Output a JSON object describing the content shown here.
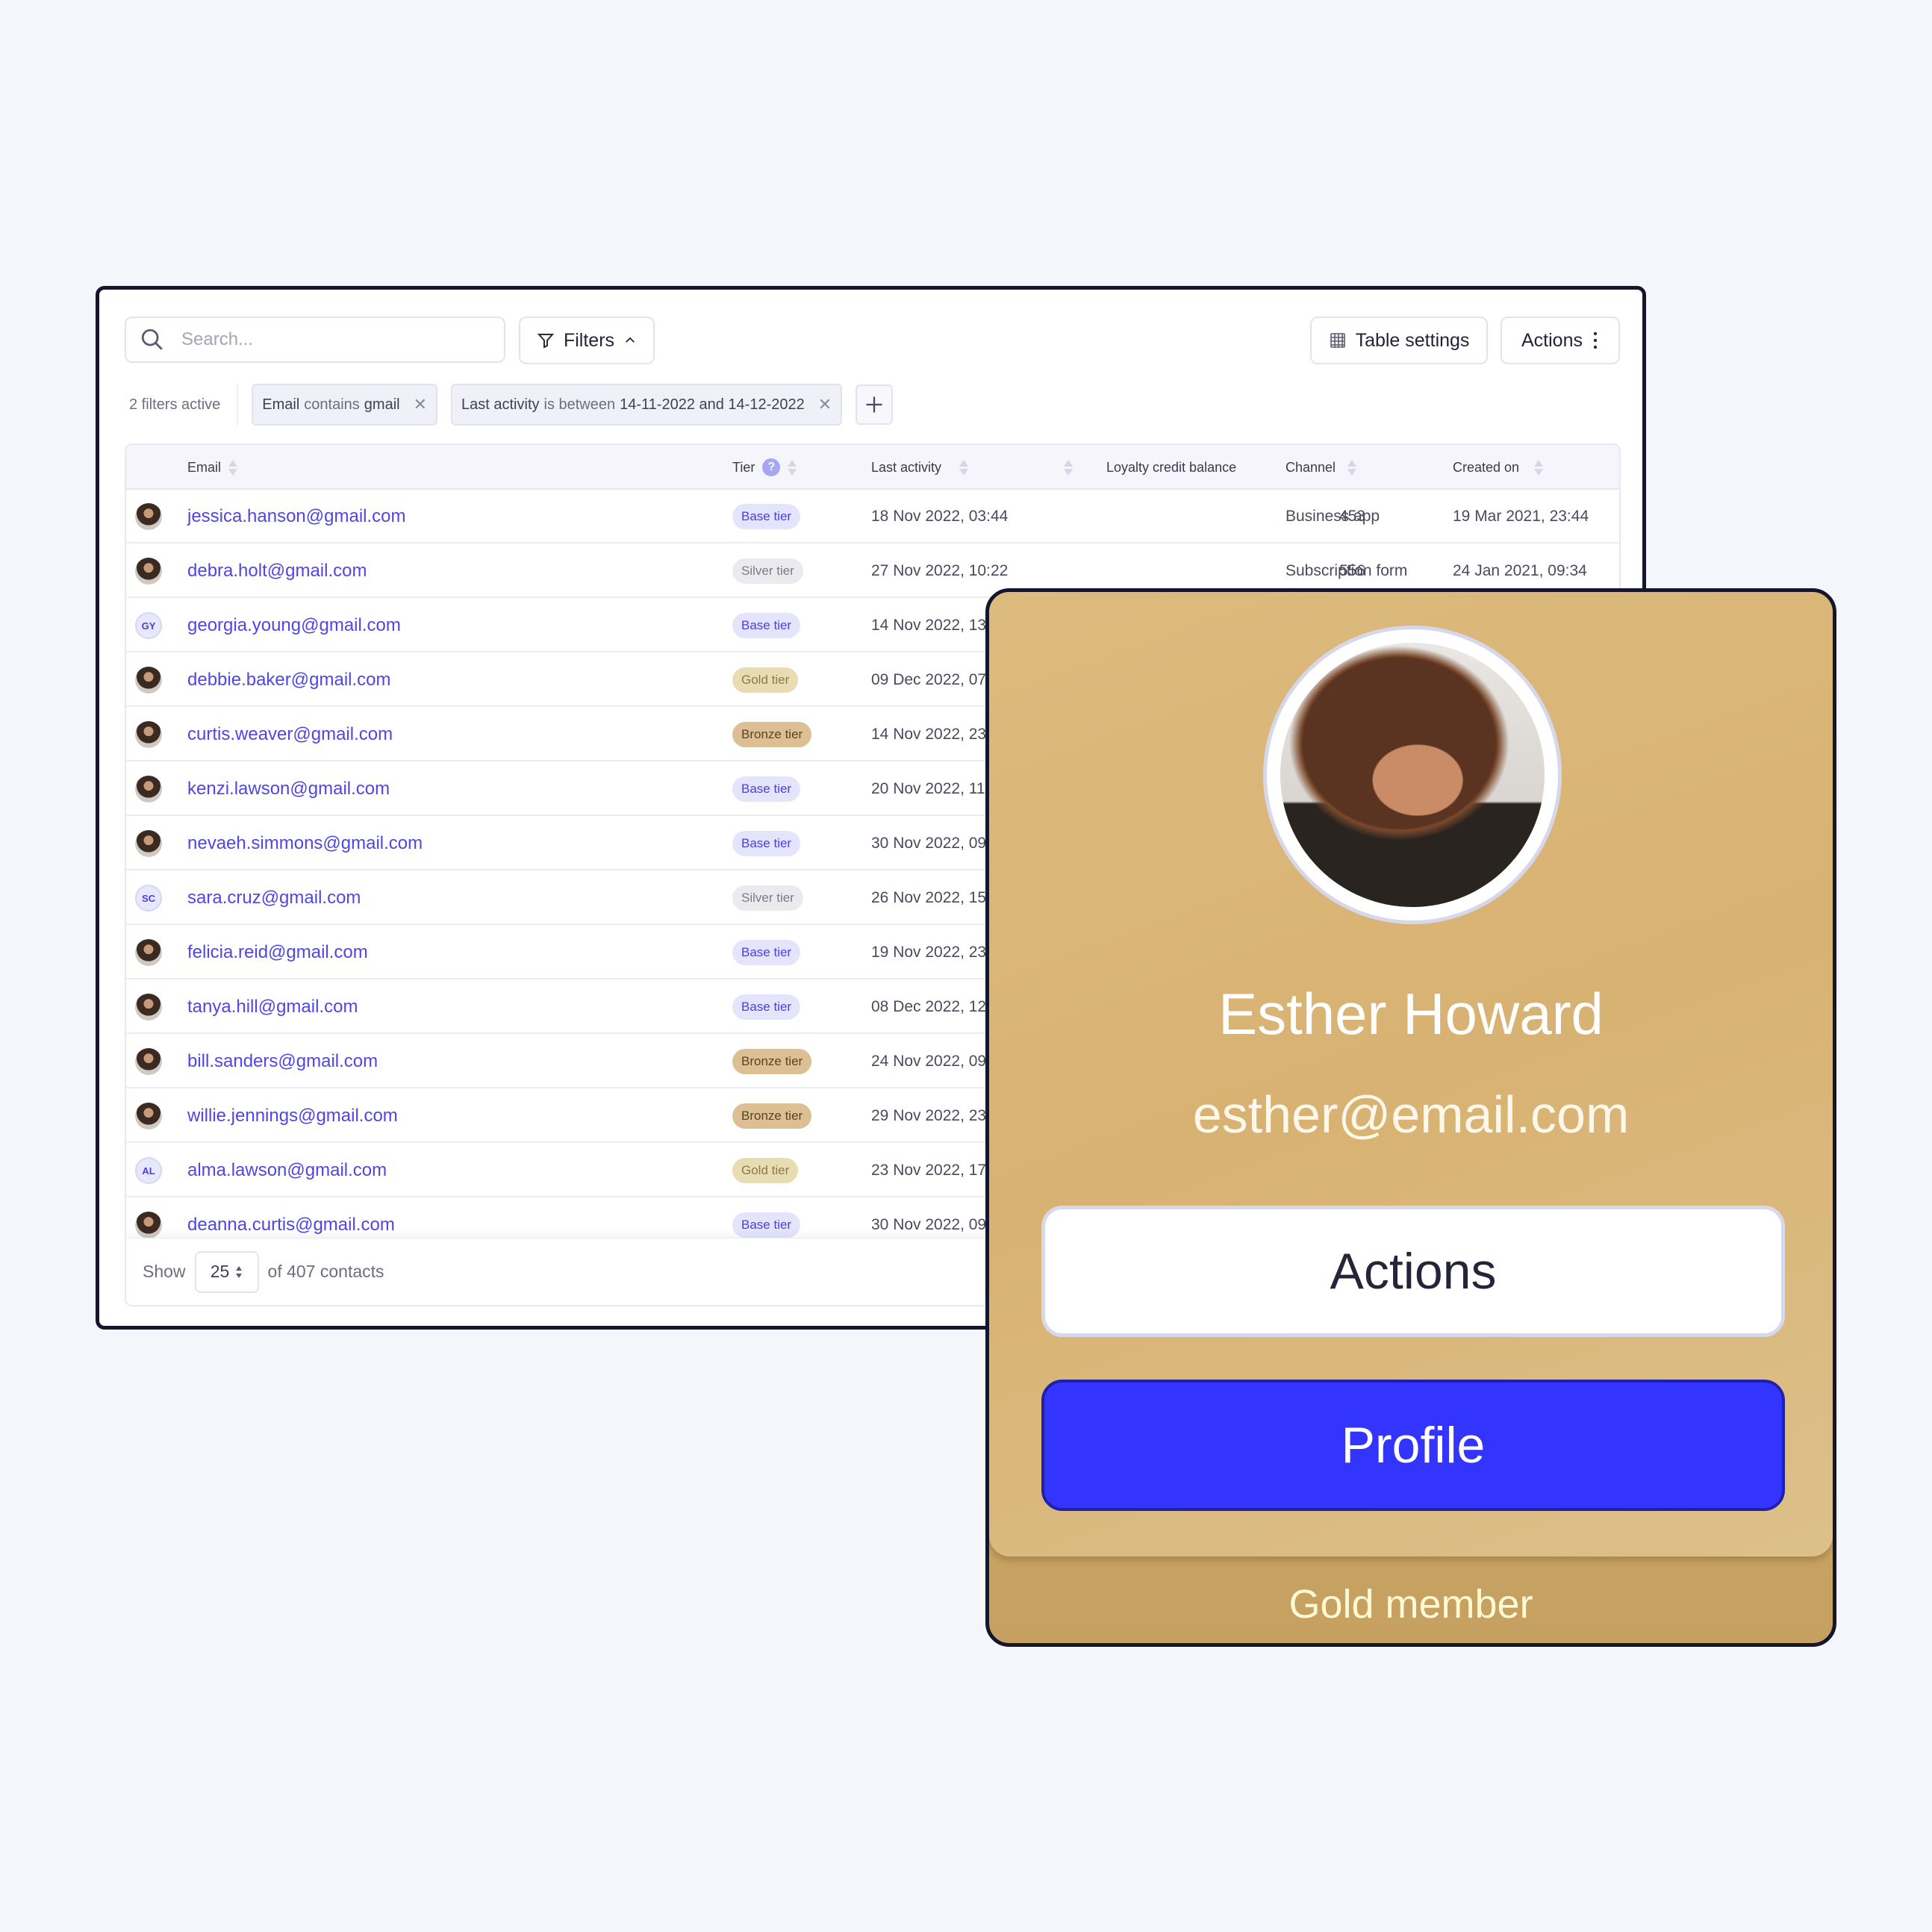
{
  "toolbar": {
    "search_placeholder": "Search...",
    "filters_label": "Filters",
    "table_settings_label": "Table settings",
    "actions_label": "Actions"
  },
  "filters": {
    "count_label": "2 filters active",
    "chips": [
      {
        "field": "Email",
        "op": "contains",
        "value": "gmail"
      },
      {
        "field": "Last activity",
        "op": "is between",
        "value": "14-11-2022 and 14-12-2022"
      }
    ]
  },
  "table": {
    "columns": {
      "email": "Email",
      "tier": "Tier",
      "last_activity": "Last activity",
      "loyalty": "Loyalty credit balance",
      "channel": "Channel",
      "created": "Created on"
    },
    "rows": [
      {
        "avatar": "photo",
        "initials": "",
        "email": "jessica.hanson@gmail.com",
        "tier": "Base tier",
        "tier_kind": "base",
        "last_activity": "18 Nov 2022, 03:44",
        "balance": "453",
        "channel": "Business app",
        "created": "19 Mar 2021, 23:44"
      },
      {
        "avatar": "photo",
        "initials": "",
        "email": "debra.holt@gmail.com",
        "tier": "Silver tier",
        "tier_kind": "silver",
        "last_activity": "27 Nov 2022, 10:22",
        "balance": "556",
        "channel": "Subscription form",
        "created": "24 Jan 2021, 09:34"
      },
      {
        "avatar": "initials",
        "initials": "GY",
        "email": "georgia.young@gmail.com",
        "tier": "Base tier",
        "tier_kind": "base",
        "last_activity": "14 Nov 2022, 13:",
        "balance": "",
        "channel": "",
        "created": ""
      },
      {
        "avatar": "photo",
        "initials": "",
        "email": "debbie.baker@gmail.com",
        "tier": "Gold tier",
        "tier_kind": "gold",
        "last_activity": "09 Dec 2022, 07",
        "balance": "",
        "channel": "",
        "created": ""
      },
      {
        "avatar": "photo",
        "initials": "",
        "email": "curtis.weaver@gmail.com",
        "tier": "Bronze tier",
        "tier_kind": "bronze",
        "last_activity": "14 Nov 2022, 23:",
        "balance": "",
        "channel": "",
        "created": ""
      },
      {
        "avatar": "photo",
        "initials": "",
        "email": "kenzi.lawson@gmail.com",
        "tier": "Base tier",
        "tier_kind": "base",
        "last_activity": "20 Nov 2022, 11:",
        "balance": "",
        "channel": "",
        "created": ""
      },
      {
        "avatar": "photo",
        "initials": "",
        "email": "nevaeh.simmons@gmail.com",
        "tier": "Base tier",
        "tier_kind": "base",
        "last_activity": "30 Nov 2022, 09",
        "balance": "",
        "channel": "",
        "created": ""
      },
      {
        "avatar": "initials",
        "initials": "SC",
        "email": "sara.cruz@gmail.com",
        "tier": "Silver tier",
        "tier_kind": "silver",
        "last_activity": "26 Nov 2022, 15:",
        "balance": "",
        "channel": "",
        "created": ""
      },
      {
        "avatar": "photo",
        "initials": "",
        "email": "felicia.reid@gmail.com",
        "tier": "Base tier",
        "tier_kind": "base",
        "last_activity": "19 Nov 2022, 23:",
        "balance": "",
        "channel": "",
        "created": ""
      },
      {
        "avatar": "photo",
        "initials": "",
        "email": "tanya.hill@gmail.com",
        "tier": "Base tier",
        "tier_kind": "base",
        "last_activity": "08 Dec 2022, 12:",
        "balance": "",
        "channel": "",
        "created": ""
      },
      {
        "avatar": "photo",
        "initials": "",
        "email": "bill.sanders@gmail.com",
        "tier": "Bronze tier",
        "tier_kind": "bronze",
        "last_activity": "24 Nov 2022, 09",
        "balance": "",
        "channel": "",
        "created": ""
      },
      {
        "avatar": "photo",
        "initials": "",
        "email": "willie.jennings@gmail.com",
        "tier": "Bronze tier",
        "tier_kind": "bronze",
        "last_activity": "29 Nov 2022, 23",
        "balance": "",
        "channel": "",
        "created": ""
      },
      {
        "avatar": "initials",
        "initials": "AL",
        "email": "alma.lawson@gmail.com",
        "tier": "Gold tier",
        "tier_kind": "gold",
        "last_activity": "23 Nov 2022, 17:",
        "balance": "",
        "channel": "",
        "created": ""
      },
      {
        "avatar": "photo",
        "initials": "",
        "email": "deanna.curtis@gmail.com",
        "tier": "Base tier",
        "tier_kind": "base",
        "last_activity": "30 Nov 2022, 09",
        "balance": "",
        "channel": "",
        "created": ""
      }
    ]
  },
  "pagination": {
    "show_label": "Show",
    "page_size": "25",
    "total_label": "of 407 contacts"
  },
  "profile_card": {
    "name": "Esther Howard",
    "email": "esther@email.com",
    "actions_label": "Actions",
    "profile_label": "Profile",
    "tier_label": "Gold member",
    "colors": {
      "gold": "#d8b272",
      "profile_button": "#3434ff"
    }
  },
  "colors": {
    "accent": "#4f46e5",
    "background": "#f5f6fc"
  }
}
